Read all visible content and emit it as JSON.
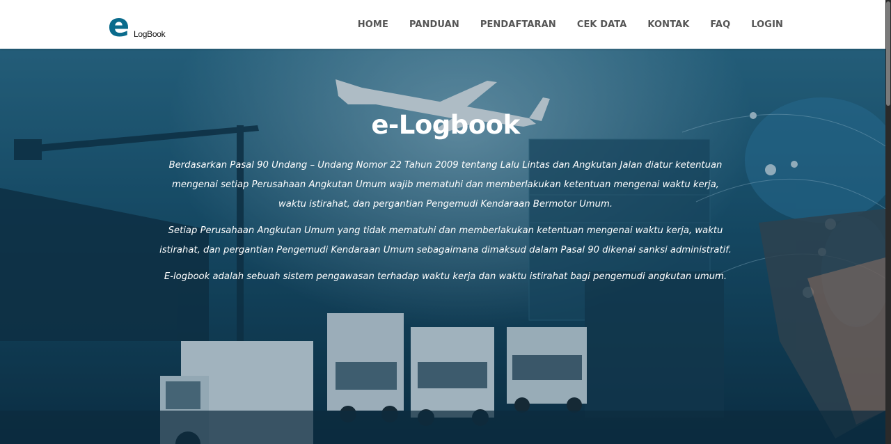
{
  "header": {
    "logo_mark": "e",
    "logo_text": "LogBook",
    "nav": [
      {
        "label": "HOME"
      },
      {
        "label": "PANDUAN"
      },
      {
        "label": "PENDAFTARAN"
      },
      {
        "label": "CEK DATA"
      },
      {
        "label": "KONTAK"
      },
      {
        "label": "FAQ"
      },
      {
        "label": "LOGIN"
      }
    ]
  },
  "hero": {
    "title": "e-Logbook",
    "paragraphs": [
      "Berdasarkan Pasal 90 Undang – Undang Nomor 22 Tahun 2009 tentang Lalu Lintas dan Angkutan Jalan diatur ketentuan mengenai setiap Perusahaan Angkutan Umum wajib mematuhi dan memberlakukan ketentuan mengenai waktu kerja, waktu istirahat, dan pergantian Pengemudi Kendaraan Bermotor Umum.",
      "Setiap Perusahaan Angkutan Umum yang tidak mematuhi dan memberlakukan ketentuan mengenai waktu kerja, waktu istirahat, dan pergantian Pengemudi Kendaraan Umum sebagaimana dimaksud dalam Pasal 90 dikenai sanksi administratif.",
      "E-logbook adalah sebuah sistem pengawasan terhadap waktu kerja dan waktu istirahat bagi pengemudi angkutan umum."
    ],
    "background_icons": [
      "airplane-icon",
      "truck-icon",
      "container-crane-icon",
      "map-pin-icon",
      "world-map-icon"
    ]
  },
  "colors": {
    "nav_text": "#555555",
    "brand": "#0a6b8c",
    "hero_text": "#ffffff"
  }
}
